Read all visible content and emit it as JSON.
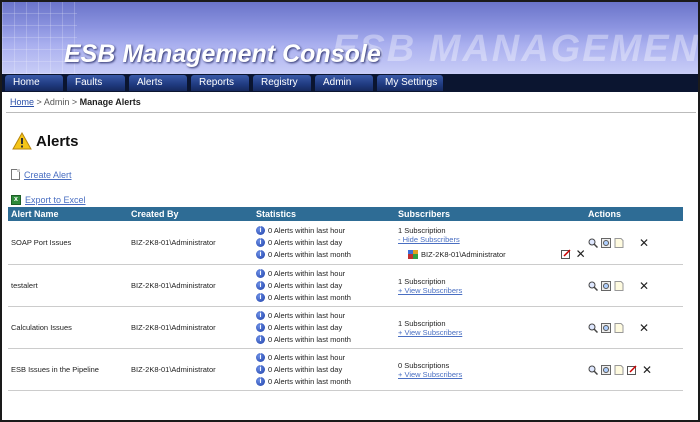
{
  "header": {
    "title": "ESB Management Console",
    "watermark": "ESB MANAGEMENT CONSOLE"
  },
  "nav": [
    "Home",
    "Faults",
    "Alerts",
    "Reports",
    "Registry",
    "Admin",
    "My Settings"
  ],
  "breadcrumb": {
    "home": "Home",
    "sep1": ">",
    "admin": "Admin",
    "sep2": ">",
    "current": "Manage Alerts"
  },
  "page": {
    "title": "Alerts",
    "create_alert": "Create Alert",
    "export": "Export to Excel"
  },
  "table": {
    "headers": [
      "Alert Name",
      "Created By",
      "Statistics",
      "Subscribers",
      "Actions"
    ],
    "rows": [
      {
        "name": "SOAP Port Issues",
        "created_by": "BIZ-2K8-01\\Administrator",
        "stats": [
          "0 Alerts within last hour",
          "0 Alerts within last day",
          "0 Alerts within last month"
        ],
        "subs": "1 Subscription",
        "subs_link": "- Hide Subscribers",
        "subscriber": "BIZ-2K8-01\\Administrator"
      },
      {
        "name": "testalert",
        "created_by": "BIZ-2K8-01\\Administrator",
        "stats": [
          "0 Alerts within last hour",
          "0 Alerts within last day",
          "0 Alerts within last month"
        ],
        "subs": "1 Subscription",
        "subs_link": "+ View Subscribers"
      },
      {
        "name": "Calculation Issues",
        "created_by": "BIZ-2K8-01\\Administrator",
        "stats": [
          "0 Alerts within last hour",
          "0 Alerts within last day",
          "0 Alerts within last month"
        ],
        "subs": "1 Subscription",
        "subs_link": "+ View Subscribers"
      },
      {
        "name": "ESB Issues in the Pipeline",
        "created_by": "BIZ-2K8-01\\Administrator",
        "stats": [
          "0 Alerts within last hour",
          "0 Alerts within last day",
          "0 Alerts within last month"
        ],
        "subs": "0 Subscriptions",
        "subs_link": "+ View Subscribers"
      }
    ]
  },
  "colors": {
    "table_header": "#2e6c95",
    "link": "#4a6fc2",
    "nav_bg": "#0b1530"
  }
}
